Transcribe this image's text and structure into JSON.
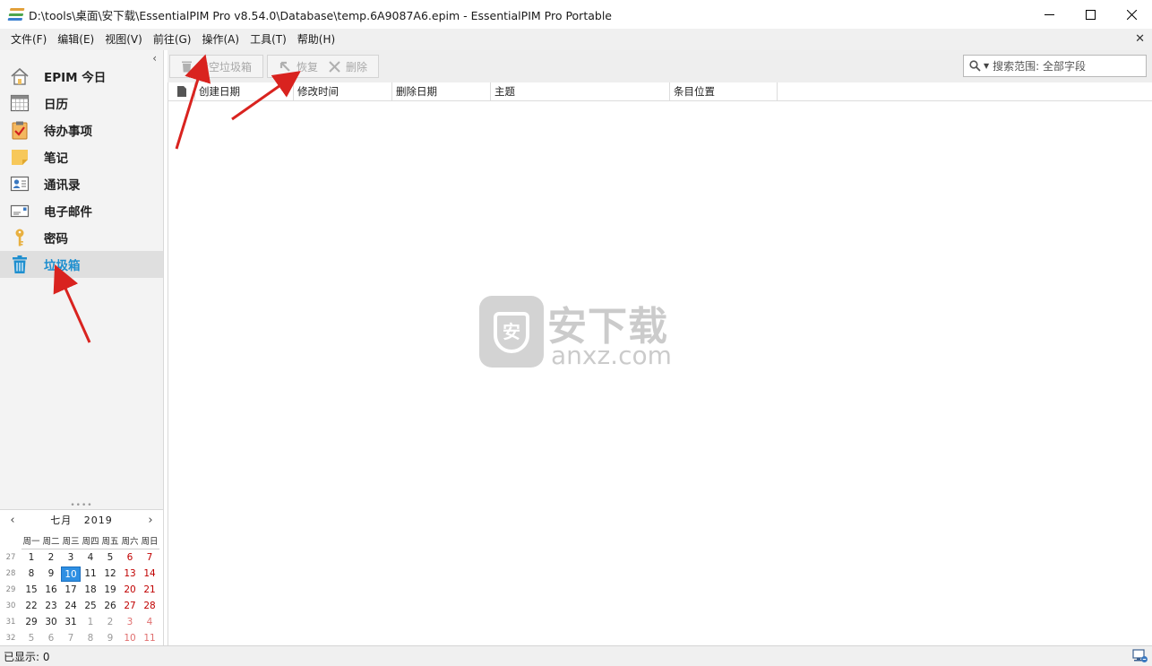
{
  "window": {
    "title": "D:\\tools\\桌面\\安下载\\EssentialPIM Pro v8.54.0\\Database\\temp.6A9087A6.epim - EssentialPIM Pro Portable"
  },
  "menu": [
    "文件(F)",
    "编辑(E)",
    "视图(V)",
    "前往(G)",
    "操作(A)",
    "工具(T)",
    "帮助(H)"
  ],
  "sidebar": {
    "items": [
      {
        "label": "EPIM 今日",
        "icon": "home-icon"
      },
      {
        "label": "日历",
        "icon": "calendar-icon"
      },
      {
        "label": "待办事项",
        "icon": "clipboard-check-icon"
      },
      {
        "label": "笔记",
        "icon": "sticky-note-icon"
      },
      {
        "label": "通讯录",
        "icon": "contact-card-icon"
      },
      {
        "label": "电子邮件",
        "icon": "envelope-icon"
      },
      {
        "label": "密码",
        "icon": "key-icon"
      },
      {
        "label": "垃圾箱",
        "icon": "trash-icon",
        "active": true
      }
    ]
  },
  "calendar": {
    "month": "七月",
    "year": "2019",
    "weekdays": [
      "周一",
      "周二",
      "周三",
      "周四",
      "周五",
      "周六",
      "周日"
    ],
    "weeks": [
      {
        "num": "27",
        "days": [
          "1",
          "2",
          "3",
          "4",
          "5",
          "6",
          "7"
        ]
      },
      {
        "num": "28",
        "days": [
          "8",
          "9",
          "10",
          "11",
          "12",
          "13",
          "14"
        ]
      },
      {
        "num": "29",
        "days": [
          "15",
          "16",
          "17",
          "18",
          "19",
          "20",
          "21"
        ]
      },
      {
        "num": "30",
        "days": [
          "22",
          "23",
          "24",
          "25",
          "26",
          "27",
          "28"
        ]
      },
      {
        "num": "31",
        "days": [
          "29",
          "30",
          "31",
          "1",
          "2",
          "3",
          "4"
        ]
      },
      {
        "num": "32",
        "days": [
          "5",
          "6",
          "7",
          "8",
          "9",
          "10",
          "11"
        ]
      }
    ],
    "today": "10"
  },
  "toolbar": {
    "empty_trash": "清空垃圾箱",
    "restore": "恢复",
    "delete": "删除",
    "search_placeholder": "搜索范围: 全部字段"
  },
  "table": {
    "columns": [
      "创建日期",
      "修改时间",
      "删除日期",
      "主题",
      "条目位置"
    ]
  },
  "watermark": {
    "big": "安下载",
    "small": "anxz.com",
    "badge": "安"
  },
  "status": {
    "shown": "已显示: 0"
  },
  "colors": {
    "accent": "#1f8fcf",
    "today": "#2e8fe3",
    "weekend": "#c00000",
    "arrow": "#d9231f"
  }
}
